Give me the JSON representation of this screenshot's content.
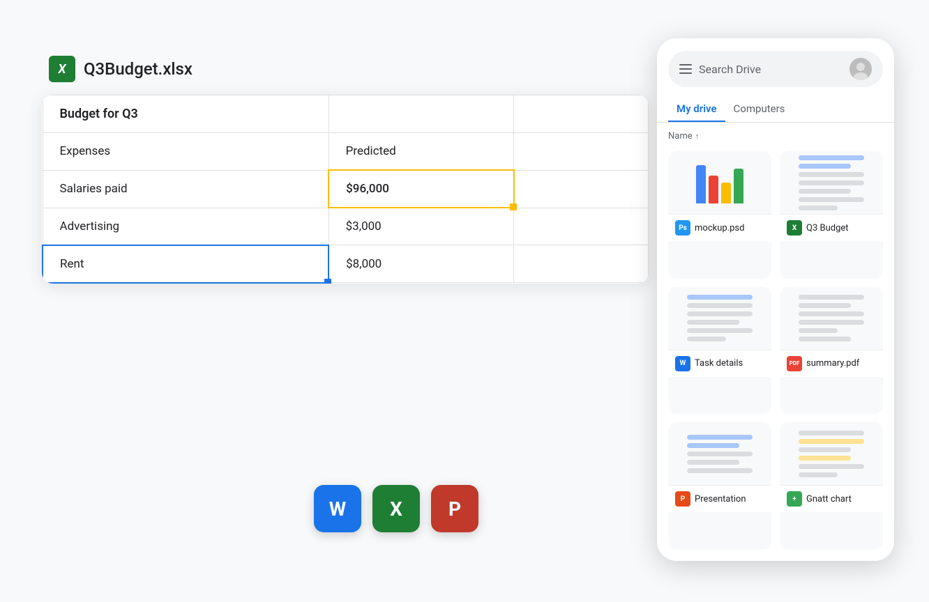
{
  "file_header": {
    "icon_label": "X",
    "file_name": "Q3Budget.xlsx"
  },
  "spreadsheet": {
    "title_row": {
      "label": "Budget for Q3"
    },
    "header_row": {
      "col1": "Expenses",
      "col2": "Predicted"
    },
    "rows": [
      {
        "label": "Salaries paid",
        "value": "$96,000"
      },
      {
        "label": "Advertising",
        "value": "$3,000"
      },
      {
        "label": "Rent",
        "value": "$8,000"
      }
    ]
  },
  "app_icons": [
    {
      "letter": "W",
      "type": "word"
    },
    {
      "letter": "X",
      "type": "excel"
    },
    {
      "letter": "P",
      "type": "powerpoint"
    }
  ],
  "drive_panel": {
    "search_placeholder": "Search Drive",
    "tabs": [
      {
        "label": "My drive",
        "active": true
      },
      {
        "label": "Computers",
        "active": false
      }
    ],
    "name_sort_label": "Name",
    "files": [
      {
        "type": "chart",
        "badge": "Ps",
        "badge_type": "ps",
        "label": "mockup.psd"
      },
      {
        "type": "doc_lines_blue",
        "badge": "X",
        "badge_type": "x",
        "label": "Q3 Budget"
      },
      {
        "type": "doc_lines",
        "badge": "W",
        "badge_type": "w",
        "label": "Task details"
      },
      {
        "type": "doc_lines2",
        "badge": "PDF",
        "badge_type": "pdf",
        "label": "summary.pdf"
      },
      {
        "type": "doc_lines3",
        "badge": "P",
        "badge_type": "p",
        "label": "Presentation"
      },
      {
        "type": "doc_lines_yellow",
        "badge": "+",
        "badge_type": "plus",
        "label": "Gnatt chart"
      }
    ]
  }
}
